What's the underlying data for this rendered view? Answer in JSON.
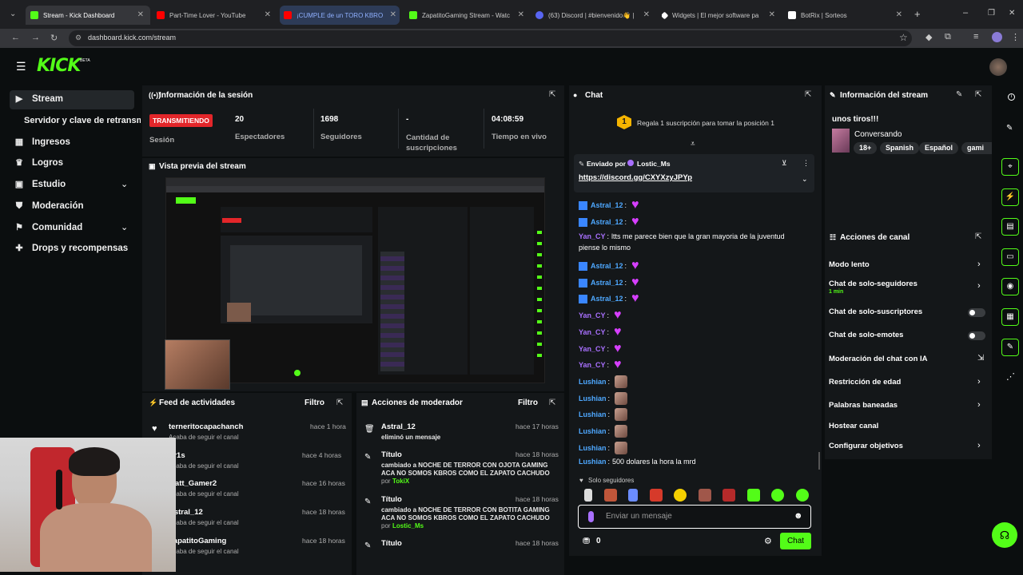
{
  "browser": {
    "tabs": [
      {
        "title": "Stream - Kick Dashboard",
        "color": "#53fc18"
      },
      {
        "title": "Part-Time Lover - YouTube",
        "color": "#ff0000"
      },
      {
        "title": "¡CUMPLE de un TORO KBRO",
        "color": "#ff0000"
      },
      {
        "title": "ZapatitoGaming Stream - Watc",
        "color": "#53fc18"
      },
      {
        "title": "(63) Discord | #bienvenido👋 |",
        "color": "#5865f2"
      },
      {
        "title": "Widgets | El mejor software pa",
        "color": "#ffffff"
      },
      {
        "title": "BotRix | Sorteos",
        "color": "#ffffff"
      }
    ],
    "url": "dashboard.kick.com/stream"
  },
  "brand": {
    "logo": "KICK",
    "beta": "BETA",
    "accent": "#53fc18"
  },
  "sidebar": {
    "items": [
      {
        "label": "Stream",
        "icon": "video-icon"
      },
      {
        "label": "Servidor y clave de retransm",
        "icon": ""
      },
      {
        "label": "Ingresos",
        "icon": "chart-icon"
      },
      {
        "label": "Logros",
        "icon": "trophy-icon"
      },
      {
        "label": "Estudio",
        "icon": "studio-icon"
      },
      {
        "label": "Moderación",
        "icon": "shield-icon"
      },
      {
        "label": "Comunidad",
        "icon": "community-icon"
      },
      {
        "label": "Drops y recompensas",
        "icon": "gift-icon"
      }
    ]
  },
  "session": {
    "title": "Información de la sesión",
    "status": "TRANSMITIENDO",
    "status_label": "Sesión",
    "stats": [
      {
        "value": "20",
        "label": "Espectadores"
      },
      {
        "value": "1698",
        "label": "Seguidores"
      },
      {
        "value": "-",
        "label": "Cantidad de suscripciones"
      },
      {
        "value": "04:08:59",
        "label": "Tiempo en vivo"
      }
    ]
  },
  "preview": {
    "title": "Vista previa del stream"
  },
  "feed": {
    "title": "Feed de actividades",
    "filter": "Filtro",
    "items": [
      {
        "name": "terneritocapachanch",
        "sub": "Acaba de seguir el canal",
        "time": "hace 1 hora"
      },
      {
        "name": "Pr1s",
        "sub": "Acaba de seguir el canal",
        "time": "hace 4 horas"
      },
      {
        "name": "Matt_Gamer2",
        "sub": "Acaba de seguir el canal",
        "time": "hace 16 horas"
      },
      {
        "name": "Astral_12",
        "sub": "Acaba de seguir el canal",
        "time": "hace 18 horas"
      },
      {
        "name": "ZapatitoGaming",
        "sub": "Acaba de seguir el canal",
        "time": "hace 18 horas"
      }
    ]
  },
  "modactions": {
    "title": "Acciones de moderador",
    "filter": "Filtro",
    "items": [
      {
        "name": "Astral_12",
        "line1": "eliminó un mensaje",
        "line2": "",
        "by_label": "",
        "by": "",
        "time": "hace 17 horas"
      },
      {
        "name": "Título",
        "line1": "cambiado a NOCHE DE TERROR CON OJOTA GAMING",
        "line2": "ACA NO SOMOS KBROS COMO EL ZAPATO CACHUDO",
        "by_label": "por",
        "by": "TokiX",
        "time": "hace 18 horas"
      },
      {
        "name": "Título",
        "line1": "cambiado a NOCHE DE TERROR CON BOTITA GAMING",
        "line2": "ACA NO SOMOS KBROS COMO EL ZAPATO CACHUDO",
        "by_label": "por",
        "by": "Lostic_Ms",
        "time": "hace 18 horas"
      },
      {
        "name": "Título",
        "line1": "",
        "line2": "",
        "by_label": "",
        "by": "",
        "time": "hace 18 horas"
      }
    ]
  },
  "chat": {
    "title": "Chat",
    "gift_rank": "1",
    "gift_text": "Regala 1 suscripción para tomar la posición 1",
    "pinned_by_label": "Enviado por",
    "pinned_by": "Lostic_Ms",
    "pinned_link": "https://discord.gg/CXYXzyJPYp",
    "messages": [
      {
        "user": "Astral_12",
        "color": "#4ea8ff",
        "text": "",
        "emote": "heart"
      },
      {
        "user": "Astral_12",
        "color": "#4ea8ff",
        "text": "",
        "emote": "heart"
      },
      {
        "user": "Yan_CY",
        "color": "#a970ff",
        "text": "ltts me parece bien que la gran mayoria de la juventud",
        "text2": "piense lo mismo",
        "emote": ""
      },
      {
        "user": "Astral_12",
        "color": "#4ea8ff",
        "text": "",
        "emote": "heart"
      },
      {
        "user": "Astral_12",
        "color": "#4ea8ff",
        "text": "",
        "emote": "heart"
      },
      {
        "user": "Astral_12",
        "color": "#4ea8ff",
        "text": "",
        "emote": "heart"
      },
      {
        "user": "Yan_CY",
        "color": "#a970ff",
        "text": "",
        "emote": "heart"
      },
      {
        "user": "Yan_CY",
        "color": "#a970ff",
        "text": "",
        "emote": "heart"
      },
      {
        "user": "Yan_CY",
        "color": "#a970ff",
        "text": "",
        "emote": "heart"
      },
      {
        "user": "Yan_CY",
        "color": "#a970ff",
        "text": "",
        "emote": "heart"
      },
      {
        "user": "Lushian",
        "color": "#4ea8ff",
        "text": "",
        "emote": "face"
      },
      {
        "user": "Lushian",
        "color": "#4ea8ff",
        "text": "",
        "emote": "face"
      },
      {
        "user": "Lushian",
        "color": "#4ea8ff",
        "text": "",
        "emote": "face"
      },
      {
        "user": "Lushian",
        "color": "#4ea8ff",
        "text": "",
        "emote": "face"
      },
      {
        "user": "Lushian",
        "color": "#4ea8ff",
        "text": "",
        "emote": "face"
      },
      {
        "user": "Lushian",
        "color": "#4ea8ff",
        "text": "500 dolares la hora la mrd",
        "emote": ""
      }
    ],
    "mode": "Solo seguidores",
    "input_placeholder": "Enviar un mensaje",
    "points": "0",
    "send": "Chat"
  },
  "stream_info": {
    "title": "Información del stream",
    "stream_title": "unos tiros!!!",
    "category": "Conversando",
    "tags": [
      "18+",
      "Spanish",
      "Español",
      "gami"
    ]
  },
  "channel_actions": {
    "title": "Acciones de canal",
    "items": [
      {
        "label": "Modo lento",
        "sub": "",
        "control": "chevron"
      },
      {
        "label": "Chat de solo-seguidores",
        "sub": "1 min",
        "control": "chevron"
      },
      {
        "label": "Chat de solo-suscriptores",
        "sub": "",
        "control": "toggle"
      },
      {
        "label": "Chat de solo-emotes",
        "sub": "",
        "control": "toggle"
      },
      {
        "label": "Moderación del chat con IA",
        "sub": "",
        "control": "external"
      },
      {
        "label": "Restricción de edad",
        "sub": "",
        "control": "chevron"
      },
      {
        "label": "Palabras baneadas",
        "sub": "",
        "control": "chevron"
      },
      {
        "label": "Hostear canal",
        "sub": "",
        "control": ""
      },
      {
        "label": "Configurar objetivos",
        "sub": "",
        "control": "chevron"
      }
    ]
  }
}
